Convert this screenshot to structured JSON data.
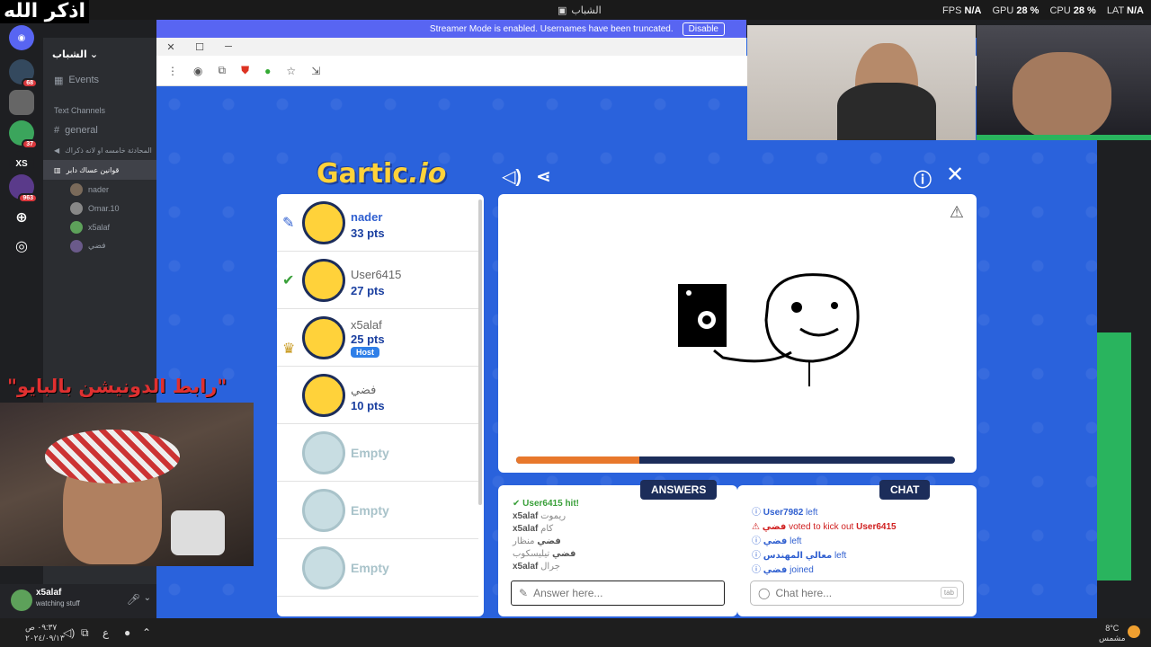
{
  "overlay": {
    "top_arabic": "اذكر الله",
    "red_banner": "\"رابط الدونيشن بالبايو\""
  },
  "topbar": {
    "title": "الشباب",
    "fps_label": "FPS",
    "fps_value": "N/A",
    "gpu_label": "GPU",
    "gpu_value": "28 %",
    "cpu_label": "CPU",
    "cpu_value": "28 %",
    "lat_label": "LAT",
    "lat_value": "N/A"
  },
  "streamer": {
    "message": "Streamer Mode is enabled. Usernames have been truncated.",
    "disable_label": "Disable"
  },
  "servers": [
    {
      "label": "",
      "badge": "68"
    },
    {
      "label": "",
      "badge": ""
    },
    {
      "label": "",
      "badge": "37"
    },
    {
      "label": "XS",
      "badge": ""
    },
    {
      "label": "",
      "badge": "963"
    }
  ],
  "sidebar": {
    "server_name": "الشباب",
    "events_label": "Events",
    "category_label": "Text Channels",
    "channels": [
      "general",
      "المحادثة خامسه او لانه ذكراك",
      "قوانين عساك دابر"
    ],
    "voice_users": [
      "nader",
      "Omar.10",
      "x5alaf",
      "فضي"
    ]
  },
  "user_panel": {
    "username": "x5alaf",
    "status": "watching stuff"
  },
  "game": {
    "logo_text": "Gartic",
    "logo_suffix": ".io",
    "players": [
      {
        "name": "nader",
        "points": "33 pts",
        "icon": "pencil-icon",
        "host": ""
      },
      {
        "name": "User6415",
        "points": "27 pts",
        "icon": "check-icon",
        "host": ""
      },
      {
        "name": "x5alaf",
        "points": "25 pts",
        "icon": "trophy-icon",
        "host": "Host"
      },
      {
        "name": "فضي",
        "points": "10 pts",
        "icon": "",
        "host": ""
      }
    ],
    "empty_label": "Empty",
    "timer_progress": 0.28,
    "answers_title": "ANSWERS",
    "chat_title": "CHAT",
    "answers": [
      {
        "user": "User6415",
        "text": "hit!"
      },
      {
        "user": "x5alaf",
        "text": "ريموت"
      },
      {
        "user": "x5alaf",
        "text": "كام"
      },
      {
        "user": "فضي",
        "text": "منظار"
      },
      {
        "user": "فضي",
        "text": "تيليسكوب"
      },
      {
        "user": "x5alaf",
        "text": "جرال"
      }
    ],
    "chat": [
      {
        "user": "User7982",
        "text": "left"
      },
      {
        "user": "فضي",
        "text": "voted to kick out",
        "target": "User6415"
      },
      {
        "user": "فضي",
        "text": "left"
      },
      {
        "user": "معالي المهندس",
        "text": "left"
      },
      {
        "user": "فضي",
        "text": "joined"
      }
    ],
    "answer_placeholder": "Answer here...",
    "chat_placeholder": "Chat here...",
    "tab_hint": "tab"
  },
  "taskbar": {
    "time": "٠٩:٣٧ ص",
    "date": "٢٠٢٤/٠٩/١٣",
    "weather": "8°C",
    "weather_desc": "مشمس"
  }
}
